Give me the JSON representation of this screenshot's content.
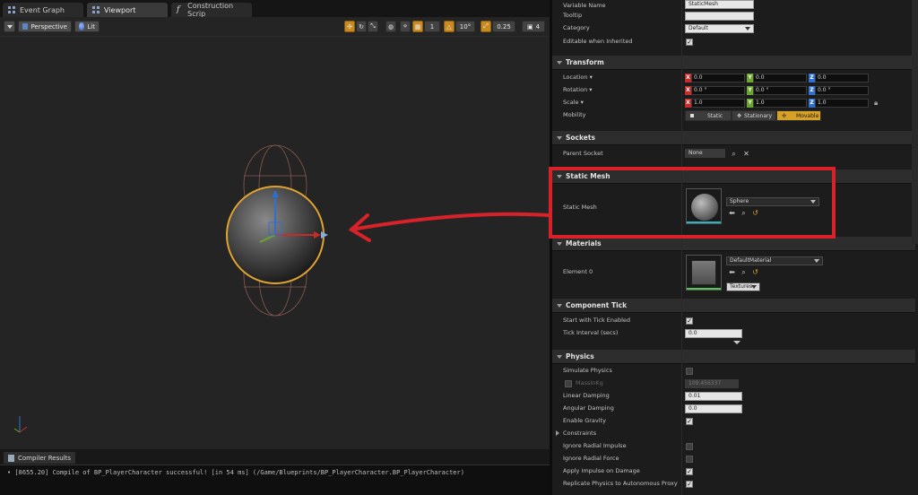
{
  "tabs": [
    {
      "label": "Event Graph",
      "icon": "grid-icon"
    },
    {
      "label": "Viewport",
      "icon": "grid-icon"
    },
    {
      "label": "Construction Scrip",
      "icon": "function-icon"
    }
  ],
  "viewport_toolbar": {
    "perspective_label": "Perspective",
    "lit_label": "Lit",
    "rotation_snap": "10°",
    "scale_snap": "0.25",
    "camera_speed": "4"
  },
  "status": {
    "tab_label": "Compiler Results",
    "log_line": "• [8655.20] Compile of BP_PlayerCharacter successful! [in 54 ms] (/Game/Blueprints/BP_PlayerCharacter.BP_PlayerCharacter)"
  },
  "details": {
    "variable_name": {
      "label": "Variable Name",
      "value": "StaticMesh"
    },
    "tooltip": {
      "label": "Tooltip",
      "value": ""
    },
    "category": {
      "label": "Category",
      "value": "Default"
    },
    "editable": {
      "label": "Editable when Inherited",
      "checked": true
    },
    "transform": {
      "title": "Transform",
      "location": {
        "label": "Location",
        "x": "0.0",
        "y": "0.0",
        "z": "0.0"
      },
      "rotation": {
        "label": "Rotation",
        "x": "0.0 °",
        "y": "0.0 °",
        "z": "0.0 °"
      },
      "scale": {
        "label": "Scale",
        "x": "1.0",
        "y": "1.0",
        "z": "1.0"
      },
      "mobility": {
        "label": "Mobility",
        "static": "Static",
        "stationary": "Stationary",
        "movable": "Movable"
      }
    },
    "sockets": {
      "title": "Sockets",
      "parent_label": "Parent Socket",
      "parent_value": "None"
    },
    "static_mesh": {
      "title": "Static Mesh",
      "label": "Static Mesh",
      "value": "Sphere"
    },
    "materials": {
      "title": "Materials",
      "element_label": "Element 0",
      "value": "DefaultMaterial",
      "textures_label": "Textures"
    },
    "component_tick": {
      "title": "Component Tick",
      "start_label": "Start with Tick Enabled",
      "start_checked": true,
      "interval_label": "Tick Interval (secs)",
      "interval_value": "0.0"
    },
    "physics": {
      "title": "Physics",
      "simulate": "Simulate Physics",
      "mass_label": "MassInKg",
      "mass_value": "109.456337",
      "linear_label": "Linear Damping",
      "linear_value": "0.01",
      "angular_label": "Angular Damping",
      "angular_value": "0.0",
      "gravity": "Enable Gravity",
      "constraints": "Constraints",
      "ignore_impulse": "Ignore Radial Impulse",
      "ignore_force": "Ignore Radial Force",
      "apply_impulse": "Apply Impulse on Damage",
      "replicate": "Replicate Physics to Autonomous Proxy"
    }
  },
  "colors": {
    "selection": "#d8222a",
    "accent": "#d7a127",
    "x_axis": "#c92a2a",
    "y_axis": "#6aa62b",
    "z_axis": "#2f6fd1"
  }
}
